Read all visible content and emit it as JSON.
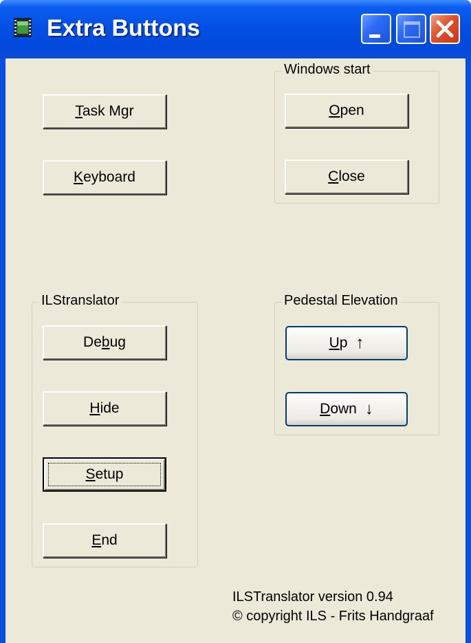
{
  "window": {
    "title": "Extra Buttons",
    "controls": {
      "minimize": "minimize",
      "maximize": "maximize",
      "close": "close"
    }
  },
  "buttons": {
    "task_mgr": {
      "pre": "",
      "key": "T",
      "post": "ask Mgr"
    },
    "keyboard": {
      "pre": "",
      "key": "K",
      "post": "eyboard"
    }
  },
  "windows_start": {
    "label": "Windows start",
    "open": {
      "pre": "",
      "key": "O",
      "post": "pen"
    },
    "close": {
      "pre": "",
      "key": "C",
      "post": "lose"
    }
  },
  "ilstranslator": {
    "label": "ILStranslator",
    "debug": {
      "pre": "De",
      "key": "b",
      "post": "ug"
    },
    "hide": {
      "pre": "",
      "key": "H",
      "post": "ide"
    },
    "setup": {
      "pre": "",
      "key": "S",
      "post": "etup"
    },
    "end": {
      "pre": "",
      "key": "E",
      "post": "nd"
    }
  },
  "pedestal": {
    "label": "Pedestal Elevation",
    "up": {
      "pre": "",
      "key": "U",
      "post": "p",
      "arrow": "↑"
    },
    "down": {
      "pre": "",
      "key": "D",
      "post": "own",
      "arrow": "↓"
    }
  },
  "footer": {
    "version": "ILSTranslator version 0.94",
    "copyright": "© copyright ILS - Frits Handgraaf"
  },
  "colors": {
    "titlebar": "#0350e4",
    "client": "#ece9d8",
    "close_button": "#e0502a"
  }
}
